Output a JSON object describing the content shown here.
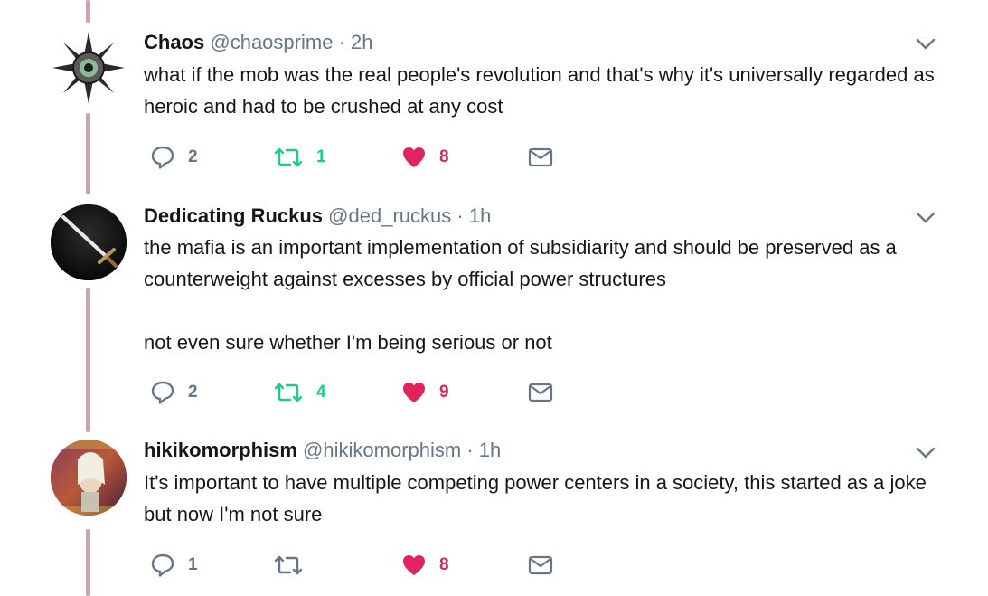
{
  "colors": {
    "thread_line": "#cfa2a6",
    "secondary_text": "#657786",
    "retweet_green": "#19cf86",
    "like_red": "#e0245e"
  },
  "tweets": [
    {
      "name": "Chaos",
      "handle": "@chaosprime",
      "separator": "·",
      "time": "2h",
      "text": "what if the mob was the real people's revolution and that's why it's universally regarded as heroic and had to be crushed at any cost",
      "replies": "2",
      "retweets": "1",
      "likes": "8",
      "liked": true,
      "avatar_icon": "chaos-star-eye-icon"
    },
    {
      "name": "Dedicating Ruckus",
      "handle": "@ded_ruckus",
      "separator": "·",
      "time": "1h",
      "text": "the mafia is an important implementation of subsidiarity and should be preserved as a counterweight against excesses by official power structures\n\nnot even sure whether I'm being serious or not",
      "replies": "2",
      "retweets": "4",
      "likes": "9",
      "liked": true,
      "avatar_icon": "sword-icon"
    },
    {
      "name": "hikikomorphism",
      "handle": "@hikikomorphism",
      "separator": "·",
      "time": "1h",
      "text": "It's important to have multiple competing power centers in a society, this started as a joke but now I'm not sure",
      "replies": "1",
      "retweets": "",
      "likes": "8",
      "liked": true,
      "avatar_icon": "portrait-icon"
    }
  ]
}
